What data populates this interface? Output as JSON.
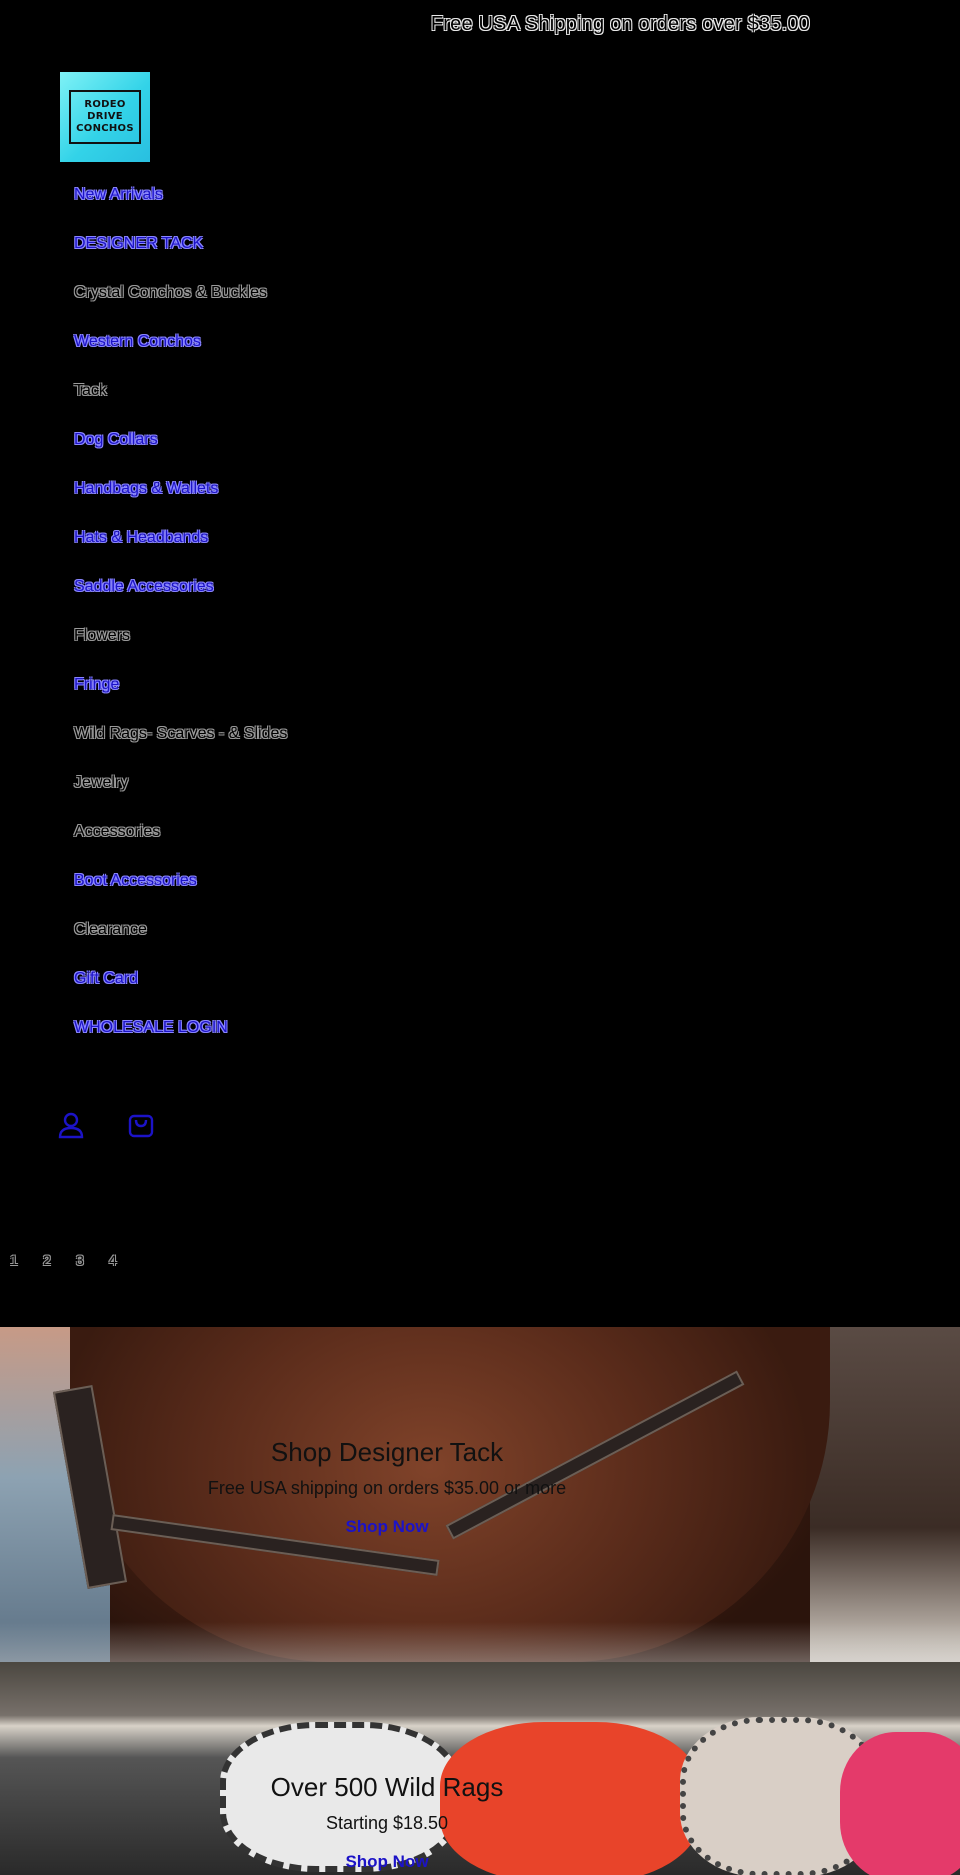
{
  "announcement": {
    "text": "Free USA Shipping on orders over $35.00"
  },
  "logo": {
    "line1": "RODEO",
    "line2": "DRIVE",
    "line3": "CONCHOS"
  },
  "nav": {
    "items": [
      {
        "label": "New Arrivals"
      },
      {
        "label": "DESIGNER TACK"
      },
      {
        "label": "Crystal Conchos & Buckles"
      },
      {
        "label": "Western Conchos"
      },
      {
        "label": "Tack"
      },
      {
        "label": "Dog Collars"
      },
      {
        "label": "Handbags & Wallets"
      },
      {
        "label": "Hats & Headbands"
      },
      {
        "label": "Saddle Accessories"
      },
      {
        "label": "Flowers"
      },
      {
        "label": "Fringe"
      },
      {
        "label": "Wild Rags- Scarves - & Slides"
      },
      {
        "label": "Jewelry"
      },
      {
        "label": "Accessories"
      },
      {
        "label": "Boot Accessories"
      },
      {
        "label": "Clearance"
      },
      {
        "label": "Gift Card"
      },
      {
        "label": "WHOLESALE LOGIN"
      }
    ]
  },
  "icons": {
    "account": "account-icon",
    "cart": "cart-icon"
  },
  "slider": {
    "pages": [
      "1",
      "2",
      "3",
      "4"
    ]
  },
  "slides": [
    {
      "title": "Shop Designer Tack",
      "subtitle": "Free USA shipping on orders $35.00 or more",
      "link": "Shop Now"
    },
    {
      "title": "Over 500 Wild Rags",
      "subtitle": "Starting $18.50",
      "link": "Shop Now"
    }
  ],
  "colors": {
    "link_blue": "#1c13c7",
    "logo_cyan": "#33d3e8",
    "background": "#000000"
  }
}
